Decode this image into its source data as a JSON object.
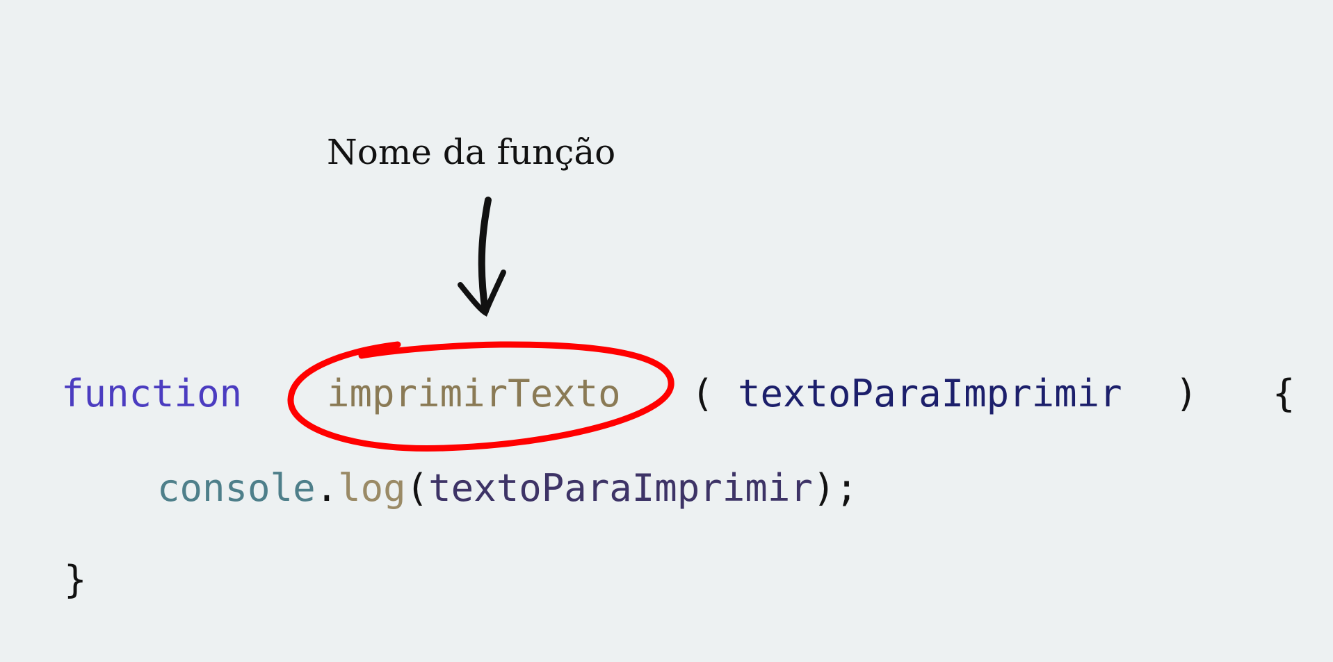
{
  "annotation": {
    "label": "Nome da função",
    "arrow_color": "#111111",
    "circle_color": "#ff0000"
  },
  "code": {
    "line1": {
      "keyword": "function",
      "name": "imprimirTexto",
      "open_paren": "(",
      "param": "textoParaImprimir",
      "close_paren": ")",
      "open_brace": "{"
    },
    "line2": {
      "object": "console",
      "dot": ".",
      "method": "log",
      "open_paren": "(",
      "arg": "textoParaImprimir",
      "close": ");"
    },
    "line3": {
      "close_brace": "}"
    }
  }
}
